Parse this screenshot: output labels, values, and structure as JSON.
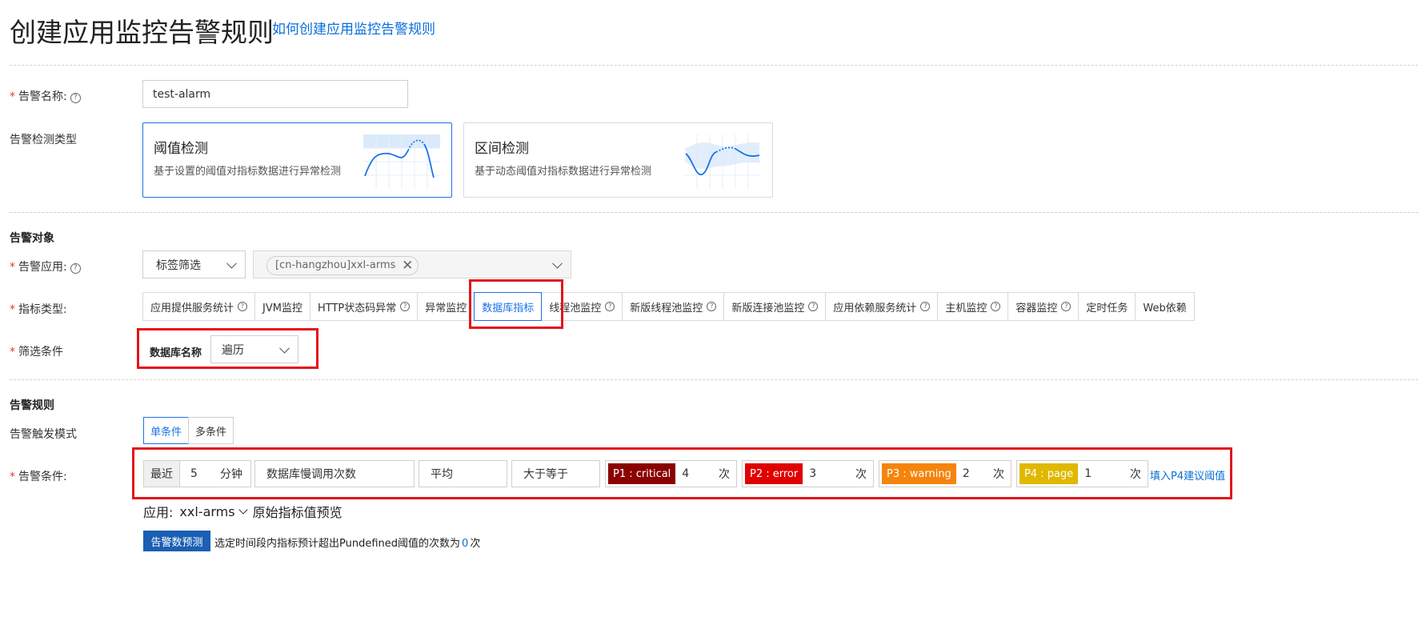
{
  "page": {
    "title": "创建应用监控告警规则",
    "help_link": "如何创建应用监控告警规则"
  },
  "form": {
    "alarm_name": {
      "label": "告警名称:",
      "value": "test-alarm"
    },
    "detect_type": {
      "label": "告警检测类型",
      "options": [
        {
          "title": "阈值检测",
          "desc": "基于设置的阈值对指标数据进行异常检测",
          "selected": true
        },
        {
          "title": "区间检测",
          "desc": "基于动态阈值对指标数据进行异常检测",
          "selected": false
        }
      ]
    }
  },
  "target": {
    "section_title": "告警对象",
    "app": {
      "label": "告警应用:",
      "filter_mode": "标签筛选",
      "tag": "[cn-hangzhou]xxl-arms"
    },
    "metric_type": {
      "label": "指标类型:",
      "tabs": [
        {
          "label": "应用提供服务统计",
          "help": true
        },
        {
          "label": "JVM监控",
          "help": false
        },
        {
          "label": "HTTP状态码异常",
          "help": true
        },
        {
          "label": "异常监控",
          "help": false
        },
        {
          "label": "数据库指标",
          "help": false,
          "active": true
        },
        {
          "label": "线程池监控",
          "help": true
        },
        {
          "label": "新版线程池监控",
          "help": true
        },
        {
          "label": "新版连接池监控",
          "help": true
        },
        {
          "label": "应用依赖服务统计",
          "help": true
        },
        {
          "label": "主机监控",
          "help": true
        },
        {
          "label": "容器监控",
          "help": true
        },
        {
          "label": "定时任务",
          "help": false
        },
        {
          "label": "Web依赖",
          "help": false
        }
      ]
    },
    "filter": {
      "label": "筛选条件",
      "field_label": "数据库名称",
      "field_value": "遍历"
    }
  },
  "rules": {
    "section_title": "告警规则",
    "trigger_mode": {
      "label": "告警触发模式",
      "options": [
        "单条件",
        "多条件"
      ],
      "selected": "单条件"
    },
    "condition": {
      "label": "告警条件:",
      "recent_label": "最近",
      "minutes_value": "5",
      "minutes_unit": "分钟",
      "metric": "数据库慢调用次数",
      "aggregation": "平均",
      "comparator": "大于等于",
      "levels": [
        {
          "tag": "P1 : critical",
          "value": "4",
          "unit": "次",
          "color": "#8b0000"
        },
        {
          "tag": "P2 : error",
          "value": "3",
          "unit": "次",
          "color": "#e00000"
        },
        {
          "tag": "P3 : warning",
          "value": "2",
          "unit": "次",
          "color": "#f5840c"
        },
        {
          "tag": "P4 : page",
          "value": "1",
          "unit": "次",
          "color": "#e0b800"
        }
      ],
      "fill_link": "填入P4建议阈值"
    },
    "preview": {
      "app_label": "应用:",
      "app_value": "xxl-arms",
      "preview_label": "原始指标值预览"
    },
    "forecast": {
      "button": "告警数预测",
      "text_before": "选定时间段内指标预计超出Pundefined阈值的次数为",
      "count": "0",
      "text_after": "次"
    }
  }
}
